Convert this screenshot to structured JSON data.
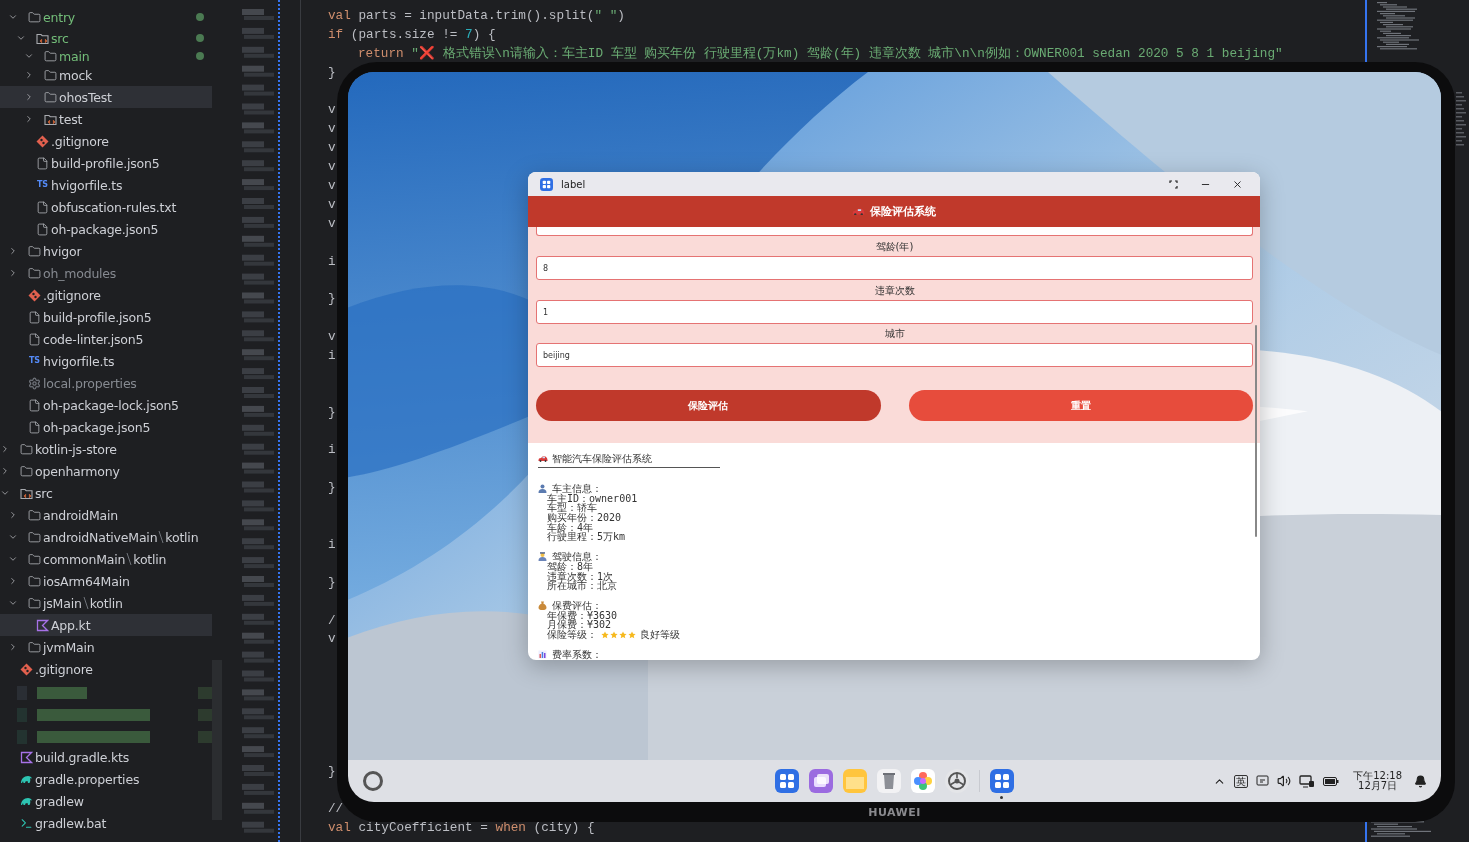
{
  "tree": {
    "continued_items": [
      {
        "label": "entry",
        "kind": "folder",
        "expanded": true,
        "selected": false,
        "color": "#73bd79",
        "modified": true,
        "children": [
          {
            "label": "src",
            "kind": "source-folder",
            "expanded": true,
            "selected": false,
            "color": "#73bd79",
            "modified": true,
            "children": [
              {
                "label": "main",
                "kind": "folder",
                "expanded": true,
                "selected": false,
                "color": "#73bd79",
                "modified": true
              },
              {
                "label": "mock",
                "kind": "folder",
                "expanded": false,
                "selected": false
              },
              {
                "label": "ohosTest",
                "kind": "folder",
                "expanded": false,
                "selected": true
              },
              {
                "label": "test",
                "kind": "source-folder",
                "expanded": false,
                "selected": false
              }
            ]
          },
          {
            "label": ".gitignore",
            "kind": "git",
            "selected": false
          },
          {
            "label": "build-profile.json5",
            "kind": "file",
            "selected": false
          },
          {
            "label": "hvigorfile.ts",
            "kind": "ts",
            "icon_text": "TS",
            "selected": false
          },
          {
            "label": "obfuscation-rules.txt",
            "kind": "file",
            "selected": false
          },
          {
            "label": "oh-package.json5",
            "kind": "file",
            "selected": false
          }
        ]
      },
      {
        "label": "hvigor",
        "kind": "folder",
        "expanded": false,
        "selected": false
      },
      {
        "label": "oh_modules",
        "kind": "folder",
        "expanded": false,
        "selected": false,
        "color": "#868a91"
      },
      {
        "label": ".gitignore",
        "kind": "git",
        "selected": false
      },
      {
        "label": "build-profile.json5",
        "kind": "file",
        "selected": false
      },
      {
        "label": "code-linter.json5",
        "kind": "file",
        "selected": false
      },
      {
        "label": "hvigorfile.ts",
        "kind": "ts",
        "icon_text": "TS",
        "selected": false
      },
      {
        "label": "local.properties",
        "kind": "settings",
        "selected": false,
        "color": "#868a91"
      },
      {
        "label": "oh-package-lock.json5",
        "kind": "file",
        "selected": false
      },
      {
        "label": "oh-package.json5",
        "kind": "file",
        "selected": false
      }
    ],
    "items": [
      {
        "label": "kotlin-js-store",
        "kind": "folder",
        "expanded": false,
        "selected": false
      },
      {
        "label": "openharmony",
        "kind": "folder",
        "expanded": false,
        "selected": false
      },
      {
        "label": "src",
        "kind": "source-folder",
        "expanded": true,
        "selected": false,
        "children": [
          {
            "label": "androidMain",
            "kind": "folder",
            "expanded": false,
            "selected": false
          },
          {
            "label": "androidNativeMain",
            "path_suffix": "kotlin",
            "kind": "folder",
            "expanded": true,
            "selected": false
          },
          {
            "label": "commonMain",
            "path_suffix": "kotlin",
            "kind": "folder",
            "expanded": true,
            "selected": false
          },
          {
            "label": "iosArm64Main",
            "kind": "folder",
            "expanded": false,
            "selected": false
          },
          {
            "label": "jsMain",
            "path_suffix": "kotlin",
            "kind": "folder",
            "expanded": true,
            "selected": false,
            "children": [
              {
                "label": "App.kt",
                "kind": "kotlin",
                "selected": true
              }
            ]
          },
          {
            "label": "jvmMain",
            "kind": "folder",
            "expanded": false,
            "selected": false
          }
        ]
      },
      {
        "label": ".gitignore",
        "kind": "git",
        "selected": false
      },
      {
        "kind": "redacted"
      },
      {
        "label": "build.gradle.kts",
        "kind": "kotlin",
        "selected": false
      },
      {
        "label": "gradle.properties",
        "kind": "gradle",
        "selected": false
      },
      {
        "label": "gradlew",
        "kind": "gradle",
        "selected": false
      },
      {
        "label": "gradlew.bat",
        "kind": "terminal",
        "selected": false
      }
    ]
  },
  "code": {
    "lines": [
      {
        "kind": "code",
        "text": "val parts = inputData.trim().split(\" \")"
      },
      {
        "kind": "code",
        "text": "if (parts.size != 7) {",
        "children": [
          {
            "kind": "code",
            "text": "return \"❌ 格式错误\\n请输入：车主ID 车型 购买年份 行驶里程(万km) 驾龄(年) 违章次数 城市\\n\\n例如：OWNER001 sedan 2020 5 8 1 beijing\""
          }
        ]
      },
      {
        "kind": "code",
        "text": "}"
      },
      {
        "kind": "blank"
      },
      {
        "kind": "code",
        "text": "v"
      },
      {
        "kind": "code",
        "text": "v"
      },
      {
        "kind": "code",
        "text": "v"
      },
      {
        "kind": "code",
        "text": "v"
      },
      {
        "kind": "code",
        "text": "v"
      },
      {
        "kind": "code",
        "text": "v"
      },
      {
        "kind": "code",
        "text": "v"
      },
      {
        "kind": "blank"
      },
      {
        "kind": "code",
        "text": "i"
      },
      {
        "kind": "blank"
      },
      {
        "kind": "code",
        "text": "}"
      },
      {
        "kind": "blank"
      },
      {
        "kind": "code",
        "text": "v"
      },
      {
        "kind": "code",
        "text": "i"
      },
      {
        "kind": "blank"
      },
      {
        "kind": "blank"
      },
      {
        "kind": "code",
        "text": "}"
      },
      {
        "kind": "blank"
      },
      {
        "kind": "code",
        "text": "i"
      },
      {
        "kind": "blank"
      },
      {
        "kind": "code",
        "text": "}"
      },
      {
        "kind": "blank"
      },
      {
        "kind": "blank"
      },
      {
        "kind": "code",
        "text": "i"
      },
      {
        "kind": "blank"
      },
      {
        "kind": "code",
        "text": "}"
      },
      {
        "kind": "blank"
      },
      {
        "kind": "code",
        "text": "/"
      },
      {
        "kind": "code",
        "text": "v"
      },
      {
        "kind": "blank"
      },
      {
        "kind": "blank"
      },
      {
        "kind": "blank"
      },
      {
        "kind": "blank"
      },
      {
        "kind": "blank"
      },
      {
        "kind": "blank"
      },
      {
        "kind": "code",
        "text": "}"
      },
      {
        "kind": "blank"
      },
      {
        "kind": "code",
        "text": "//"
      },
      {
        "kind": "code",
        "text": "val cityCoefficient = when (city) {"
      }
    ]
  },
  "tablet": {
    "brand": "HUAWEI",
    "app_window": {
      "title": "label",
      "header": "保险评估系统",
      "fields": [
        {
          "label": "驾龄(年)",
          "value": "8"
        },
        {
          "label": "违章次数",
          "value": "1"
        },
        {
          "label": "城市",
          "value": "beijing"
        }
      ],
      "buttons": [
        {
          "label": "保险评估",
          "kind": "primary"
        },
        {
          "label": "重置",
          "kind": "secondary"
        }
      ],
      "result": {
        "title": "智能汽车保险评估系统",
        "sections": [
          {
            "kind": "owner",
            "heading": "车主信息：",
            "lines": [
              {
                "kind": "text",
                "text": "车主ID：owner001"
              },
              {
                "kind": "text",
                "text": "车型：轿车"
              },
              {
                "kind": "text",
                "text": "购买年份：2020"
              },
              {
                "kind": "text",
                "text": "车龄：4年"
              },
              {
                "kind": "text",
                "text": "行驶里程：5万km"
              }
            ]
          },
          {
            "kind": "driver",
            "heading": "驾驶信息：",
            "lines": [
              {
                "kind": "text",
                "text": "驾龄：8年"
              },
              {
                "kind": "text",
                "text": "违章次数：1次"
              },
              {
                "kind": "text",
                "text": "所在城市：北京"
              }
            ]
          },
          {
            "kind": "premium",
            "heading": "保费评估：",
            "lines": [
              {
                "kind": "text",
                "text": "年保费：¥3630"
              },
              {
                "kind": "text",
                "text": "月保费：¥302"
              },
              {
                "kind": "rating",
                "text": "保险等级：",
                "stars": 4,
                "note": "良好等级"
              }
            ]
          },
          {
            "kind": "rates",
            "heading": "费率系数："
          }
        ]
      }
    }
  },
  "taskbar": {
    "dock": [
      {
        "kind": "app-grid",
        "running": false
      },
      {
        "kind": "multitask",
        "running": false
      },
      {
        "kind": "files",
        "running": false
      },
      {
        "kind": "trash",
        "running": false
      },
      {
        "kind": "photos",
        "running": false
      },
      {
        "kind": "settings",
        "running": false
      },
      {
        "kind": "separator"
      },
      {
        "kind": "app-grid",
        "running": true
      }
    ],
    "ime": "英",
    "time": "下午12:18",
    "date": "12月7日"
  }
}
